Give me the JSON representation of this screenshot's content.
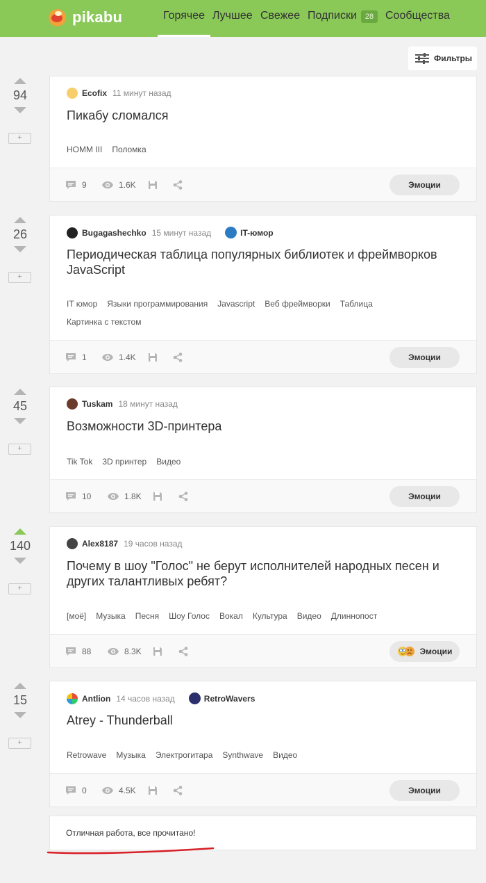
{
  "header": {
    "logo": "pikabu",
    "nav": [
      {
        "label": "Горячее",
        "active": true
      },
      {
        "label": "Лучшее"
      },
      {
        "label": "Свежее"
      },
      {
        "label": "Подписки",
        "badge": "28"
      },
      {
        "label": "Сообщества"
      }
    ]
  },
  "filter": {
    "label": "Фильтры"
  },
  "emotions_label": "Эмоции",
  "stories": [
    {
      "rating": "94",
      "author": "Ecofix",
      "time": "11 минут назад",
      "community": "",
      "title": "Пикабу сломался",
      "tags": [
        "HOMM III",
        "Поломка"
      ],
      "comments": "9",
      "views": "1.6K"
    },
    {
      "rating": "26",
      "author": "Bugagashechko",
      "time": "15 минут назад",
      "community": "IT-юмор",
      "title": "Периодическая таблица популярных библиотек и фреймворков JavaScript",
      "tags": [
        "IT юмор",
        "Языки программирования",
        "Javascript",
        "Веб фреймворки",
        "Таблица",
        "Картинка с текстом"
      ],
      "comments": "1",
      "views": "1.4K"
    },
    {
      "rating": "45",
      "author": "Tuskam",
      "time": "18 минут назад",
      "community": "",
      "title": "Возможности 3D-принтера",
      "tags": [
        "Tik Tok",
        "3D принтер",
        "Видео"
      ],
      "comments": "10",
      "views": "1.8K"
    },
    {
      "rating": "140",
      "author": "Alex8187",
      "time": "19 часов назад",
      "community": "",
      "title": "Почему в шоу \"Голос\" не берут исполнителей народных песен и других талантливых ребят?",
      "tags": [
        "[моё]",
        "Музыка",
        "Песня",
        "Шоу Голос",
        "Вокал",
        "Культура",
        "Видео",
        "Длиннопост"
      ],
      "comments": "88",
      "views": "8.3K"
    },
    {
      "rating": "15",
      "author": "Antlion",
      "time": "14 часов назад",
      "community": "RetroWavers",
      "title": "Atrey - Thunderball",
      "tags": [
        "Retrowave",
        "Музыка",
        "Электрогитара",
        "Synthwave",
        "Видео"
      ],
      "comments": "0",
      "views": "4.5K"
    }
  ],
  "final_message": "Отличная работа, все прочитано!"
}
